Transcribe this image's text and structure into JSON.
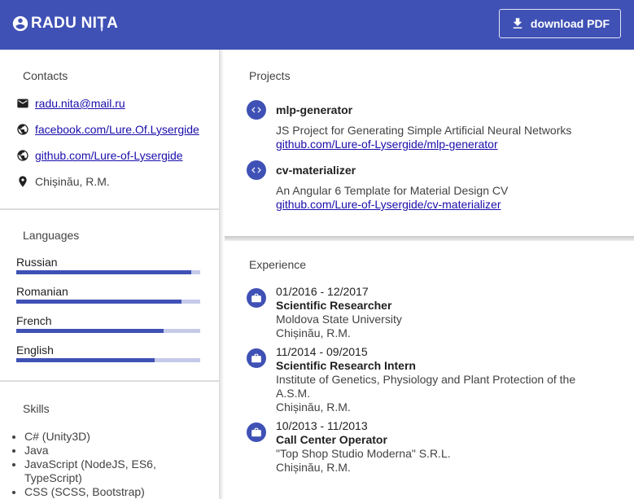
{
  "header": {
    "name": "RADU NIȚA",
    "pdf_label": "download PDF"
  },
  "contacts": {
    "title": "Contacts",
    "email": "radu.nita@mail.ru",
    "facebook": "facebook.com/Lure.Of.Lysergide",
    "github": "github.com/Lure-of-Lysergide",
    "location": "Chișinău, R.M."
  },
  "languages": {
    "title": "Languages",
    "items": [
      {
        "name": "Russian",
        "level": 0.95
      },
      {
        "name": "Romanian",
        "level": 0.9
      },
      {
        "name": "French",
        "level": 0.8
      },
      {
        "name": "English",
        "level": 0.75
      }
    ]
  },
  "skills": {
    "title": "Skills",
    "items": [
      "C# (Unity3D)",
      "Java",
      "JavaScript (NodeJS, ES6, TypeScript)",
      "CSS (SCSS, Bootstrap)"
    ]
  },
  "projects": {
    "title": "Projects",
    "items": [
      {
        "name": "mlp-generator",
        "description": "JS Project for Generating Simple Artificial Neural Networks",
        "link": "github.com/Lure-of-Lysergide/mlp-generator"
      },
      {
        "name": "cv-materializer",
        "description": "An Angular 6 Template for Material Design CV",
        "link": "github.com/Lure-of-Lysergide/cv-materializer"
      }
    ]
  },
  "experience": {
    "title": "Experience",
    "items": [
      {
        "dates": "01/2016 - 12/2017",
        "role": "Scientific Researcher",
        "org": "Moldova State University",
        "location": "Chișinău, R.M."
      },
      {
        "dates": "11/2014 - 09/2015",
        "role": "Scientific Research Intern",
        "org": "Institute of Genetics, Physiology and Plant Protection of the A.S.M.",
        "location": "Chișinău, R.M."
      },
      {
        "dates": "10/2013 - 11/2013",
        "role": "Call Center Operator",
        "org": "\"Top Shop Studio Moderna\" S.R.L.",
        "location": "Chișinău, R.M."
      }
    ]
  },
  "colors": {
    "primary": "#3f51b5",
    "bar_track": "#c5cae9",
    "link": "#1a0dab"
  }
}
